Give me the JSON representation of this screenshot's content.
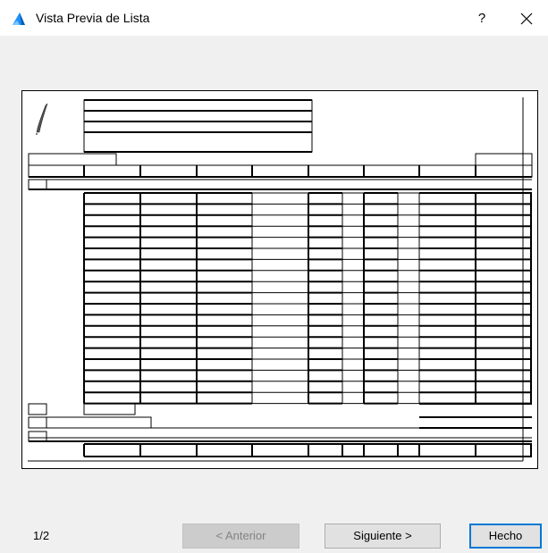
{
  "window": {
    "title": "Vista Previa de Lista",
    "help_label": "?",
    "icons": {
      "app": "archicad-logo-icon",
      "close": "close-icon",
      "help": "help-icon"
    }
  },
  "preview": {
    "description_icon": "feather-pen-icon"
  },
  "footer": {
    "page_indicator": "1/2",
    "prev_label": "< Anterior",
    "next_label": "Siguiente >",
    "done_label": "Hecho"
  },
  "colors": {
    "accent": "#0078d7",
    "app_icon": "#1e90ff"
  }
}
